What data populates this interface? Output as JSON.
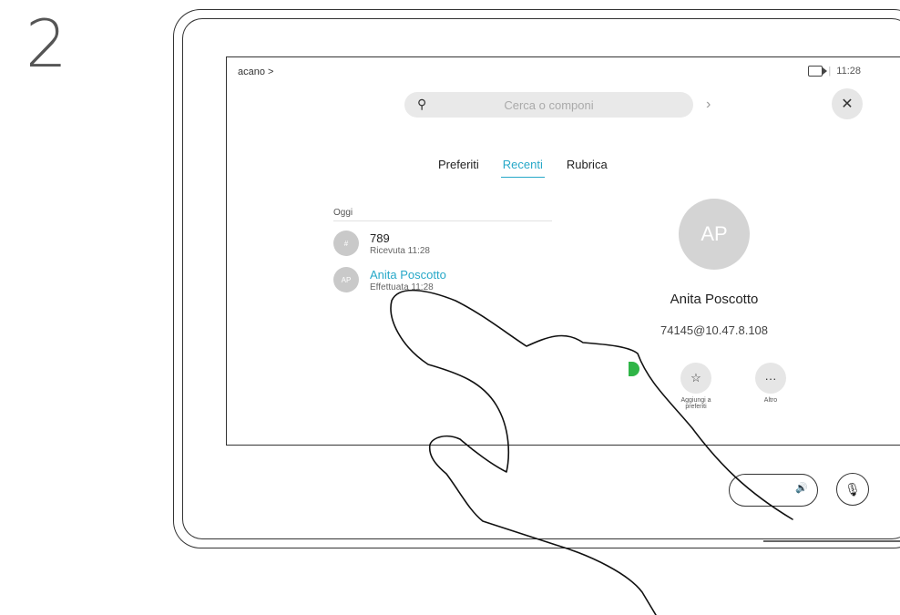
{
  "step_number": "2",
  "header": {
    "breadcrumb": "acano >",
    "time": "11:28",
    "status_separator": "|"
  },
  "search": {
    "placeholder": "Cerca o componi"
  },
  "tabs": [
    {
      "label": "Preferiti",
      "active": false
    },
    {
      "label": "Recenti",
      "active": true
    },
    {
      "label": "Rubrica",
      "active": false
    }
  ],
  "recents": {
    "section_label": "Oggi",
    "items": [
      {
        "avatar": "#",
        "name": "789",
        "detail": "Ricevuta 11:28"
      },
      {
        "avatar": "AP",
        "name": "Anita Poscotto",
        "detail": "Effettuata 11:28"
      }
    ]
  },
  "detail": {
    "avatar": "AP",
    "name": "Anita Poscotto",
    "address": "74145@10.47.8.108",
    "actions": [
      {
        "icon": "star-icon",
        "label": "Aggiungi a preferiti"
      },
      {
        "icon": "more-icon",
        "label": "Altro"
      }
    ]
  },
  "colors": {
    "accent": "#27a8c8",
    "call_green": "#2fb547"
  },
  "icons": [
    "search-icon",
    "chevron-right-icon",
    "close-icon",
    "camera-icon",
    "volume-icon",
    "mic-muted-icon"
  ]
}
